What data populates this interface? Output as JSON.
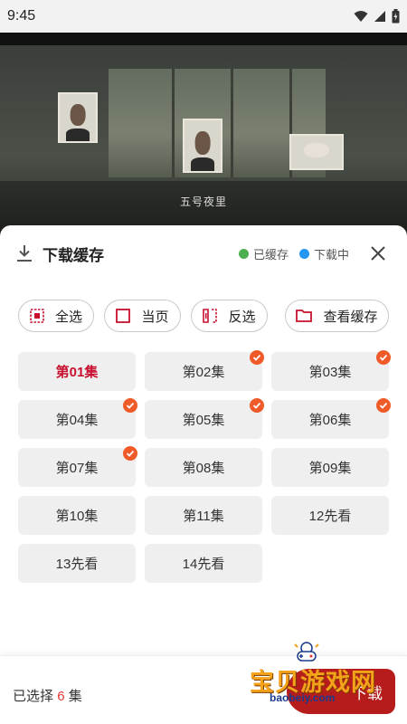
{
  "status_bar": {
    "time": "9:45"
  },
  "video": {
    "subtitle": "五号夜里"
  },
  "sheet": {
    "title": "下载缓存",
    "legend": [
      {
        "label": "已缓存",
        "color": "#4caf50"
      },
      {
        "label": "下载中",
        "color": "#2196f3"
      }
    ]
  },
  "actions": {
    "select_all": "全选",
    "current_page": "当页",
    "invert": "反选",
    "view_cache": "查看缓存"
  },
  "episodes": [
    {
      "label": "第01集",
      "active": true,
      "checked": false
    },
    {
      "label": "第02集",
      "active": false,
      "checked": true
    },
    {
      "label": "第03集",
      "active": false,
      "checked": true
    },
    {
      "label": "第04集",
      "active": false,
      "checked": true
    },
    {
      "label": "第05集",
      "active": false,
      "checked": true
    },
    {
      "label": "第06集",
      "active": false,
      "checked": true
    },
    {
      "label": "第07集",
      "active": false,
      "checked": true
    },
    {
      "label": "第08集",
      "active": false,
      "checked": false
    },
    {
      "label": "第09集",
      "active": false,
      "checked": false
    },
    {
      "label": "第10集",
      "active": false,
      "checked": false
    },
    {
      "label": "第11集",
      "active": false,
      "checked": false
    },
    {
      "label": "12先看",
      "active": false,
      "checked": false
    },
    {
      "label": "13先看",
      "active": false,
      "checked": false
    },
    {
      "label": "14先看",
      "active": false,
      "checked": false
    }
  ],
  "footer": {
    "selected_prefix": "已选择",
    "selected_count": "6",
    "selected_suffix": "集",
    "download_label": "下载"
  },
  "watermark": {
    "text": "宝贝游戏网",
    "url": "baobeiy.com"
  },
  "colors": {
    "accent": "#c8102e",
    "check": "#f05a28",
    "download": "#b71c1c"
  }
}
